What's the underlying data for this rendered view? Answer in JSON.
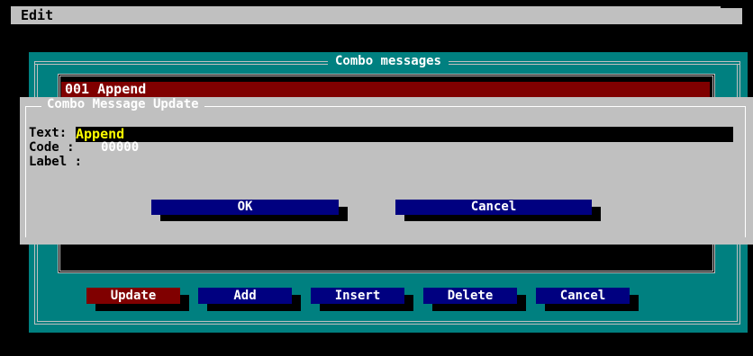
{
  "menu": {
    "edit": "Edit"
  },
  "combo_window": {
    "title": "Combo messages",
    "list_items": [
      "001 Append"
    ],
    "buttons": {
      "update": "Update",
      "add": "Add",
      "insert": "Insert",
      "delete": "Delete",
      "cancel": "Cancel"
    }
  },
  "dialog": {
    "title": "Combo Message Update",
    "text_label": "Text:",
    "text_value": "Append",
    "code_label": "Code  :",
    "code_value": "00000",
    "label_label": "Label :",
    "ok_label": "OK",
    "cancel_label": "Cancel"
  },
  "colors": {
    "teal": "#008080",
    "gray": "#c0c0c0",
    "navy": "#000080",
    "maroon": "#800000",
    "yellow": "#ffff00"
  }
}
